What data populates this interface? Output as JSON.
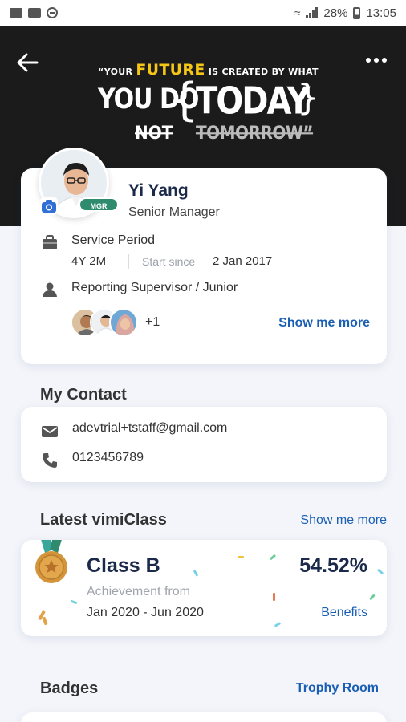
{
  "status_bar": {
    "battery": "28%",
    "time": "13:05"
  },
  "header": {
    "quote": {
      "prefix": "“YOUR",
      "future": "FUTURE",
      "middle": "IS CREATED BY WHAT",
      "you_do": "YOU DO",
      "not": "NOT",
      "brace_open": "{",
      "today": "TODAY",
      "brace_close": "}",
      "tomorrow": "TOMORROW”"
    },
    "icons": {
      "back": "arrow-left-icon",
      "more": "more-horizontal-icon"
    }
  },
  "profile": {
    "name": "Yi Yang",
    "title": "Senior Manager",
    "badge": "MGR",
    "service_period_label": "Service Period",
    "service_duration": "4Y 2M",
    "start_since_label": "Start since",
    "start_date": "2 Jan 2017",
    "reporting_label": "Reporting Supervisor / Junior",
    "extra_count": "+1",
    "show_more": "Show me more"
  },
  "contact": {
    "title": "My Contact",
    "email": "adevtrial+tstaff@gmail.com",
    "phone": "0123456789"
  },
  "vimiclass": {
    "title": "Latest vimiClass",
    "show_more": "Show me more",
    "class_name": "Class B",
    "percentage": "54.52%",
    "achievement_label": "Achievement from",
    "period": "Jan 2020 - Jun 2020",
    "benefits": "Benefits"
  },
  "badges": {
    "title": "Badges",
    "trophy_room": "Trophy Room"
  },
  "colors": {
    "link": "#1a5fb4",
    "navy": "#1b2a4a",
    "medal": "#d4943a",
    "badge_green": "#2e8b6e",
    "quote_accent": "#f5c518"
  }
}
